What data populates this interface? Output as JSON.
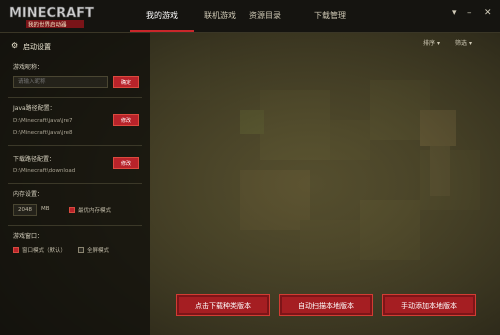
{
  "app": {
    "logo_text": "MINECRAFT",
    "logo_subtitle": "我的世界启动器"
  },
  "nav": {
    "tabs": [
      {
        "label": "我的游戏",
        "active": true
      },
      {
        "label": "联机游戏"
      },
      {
        "label": "资源目录"
      },
      {
        "label": "下载管理"
      }
    ]
  },
  "window": {
    "menu_icon": "chevron-down-icon",
    "minimize_icon": "minimize-icon",
    "close_icon": "close-icon"
  },
  "settings": {
    "title": "启动设置",
    "player_name_label": "游戏昵称：",
    "player_name_placeholder": "请输入昵称",
    "confirm_label": "确定",
    "java_label": "Java路径配置：",
    "java_paths": [
      "D:\\Minecraft\\java\\jre7",
      "D:\\Minecraft\\java\\jre8"
    ],
    "java_modify_label": "修改",
    "download_label": "下载路径配置：",
    "download_path": "D:\\Minecraft\\download",
    "download_modify_label": "修改",
    "memory_label": "内存设置：",
    "memory_value": "2048",
    "memory_unit": "MB",
    "optimal_memory_label": "最优内存模式",
    "optimal_memory_checked": true,
    "window_label": "游戏窗口：",
    "windowed_label": "窗口模式（默认）",
    "windowed_checked": true,
    "fullscreen_label": "全屏模式",
    "fullscreen_checked": false
  },
  "controls": {
    "sort_label": "排序",
    "filter_label": "筛选"
  },
  "actions": {
    "download_btn": "点击下载种类版本",
    "scan_btn": "自动扫描本地版本",
    "add_btn": "手动添加本地版本"
  },
  "colors": {
    "accent": "#b8232a",
    "topbar": "#151410",
    "panel": "#12110c"
  }
}
